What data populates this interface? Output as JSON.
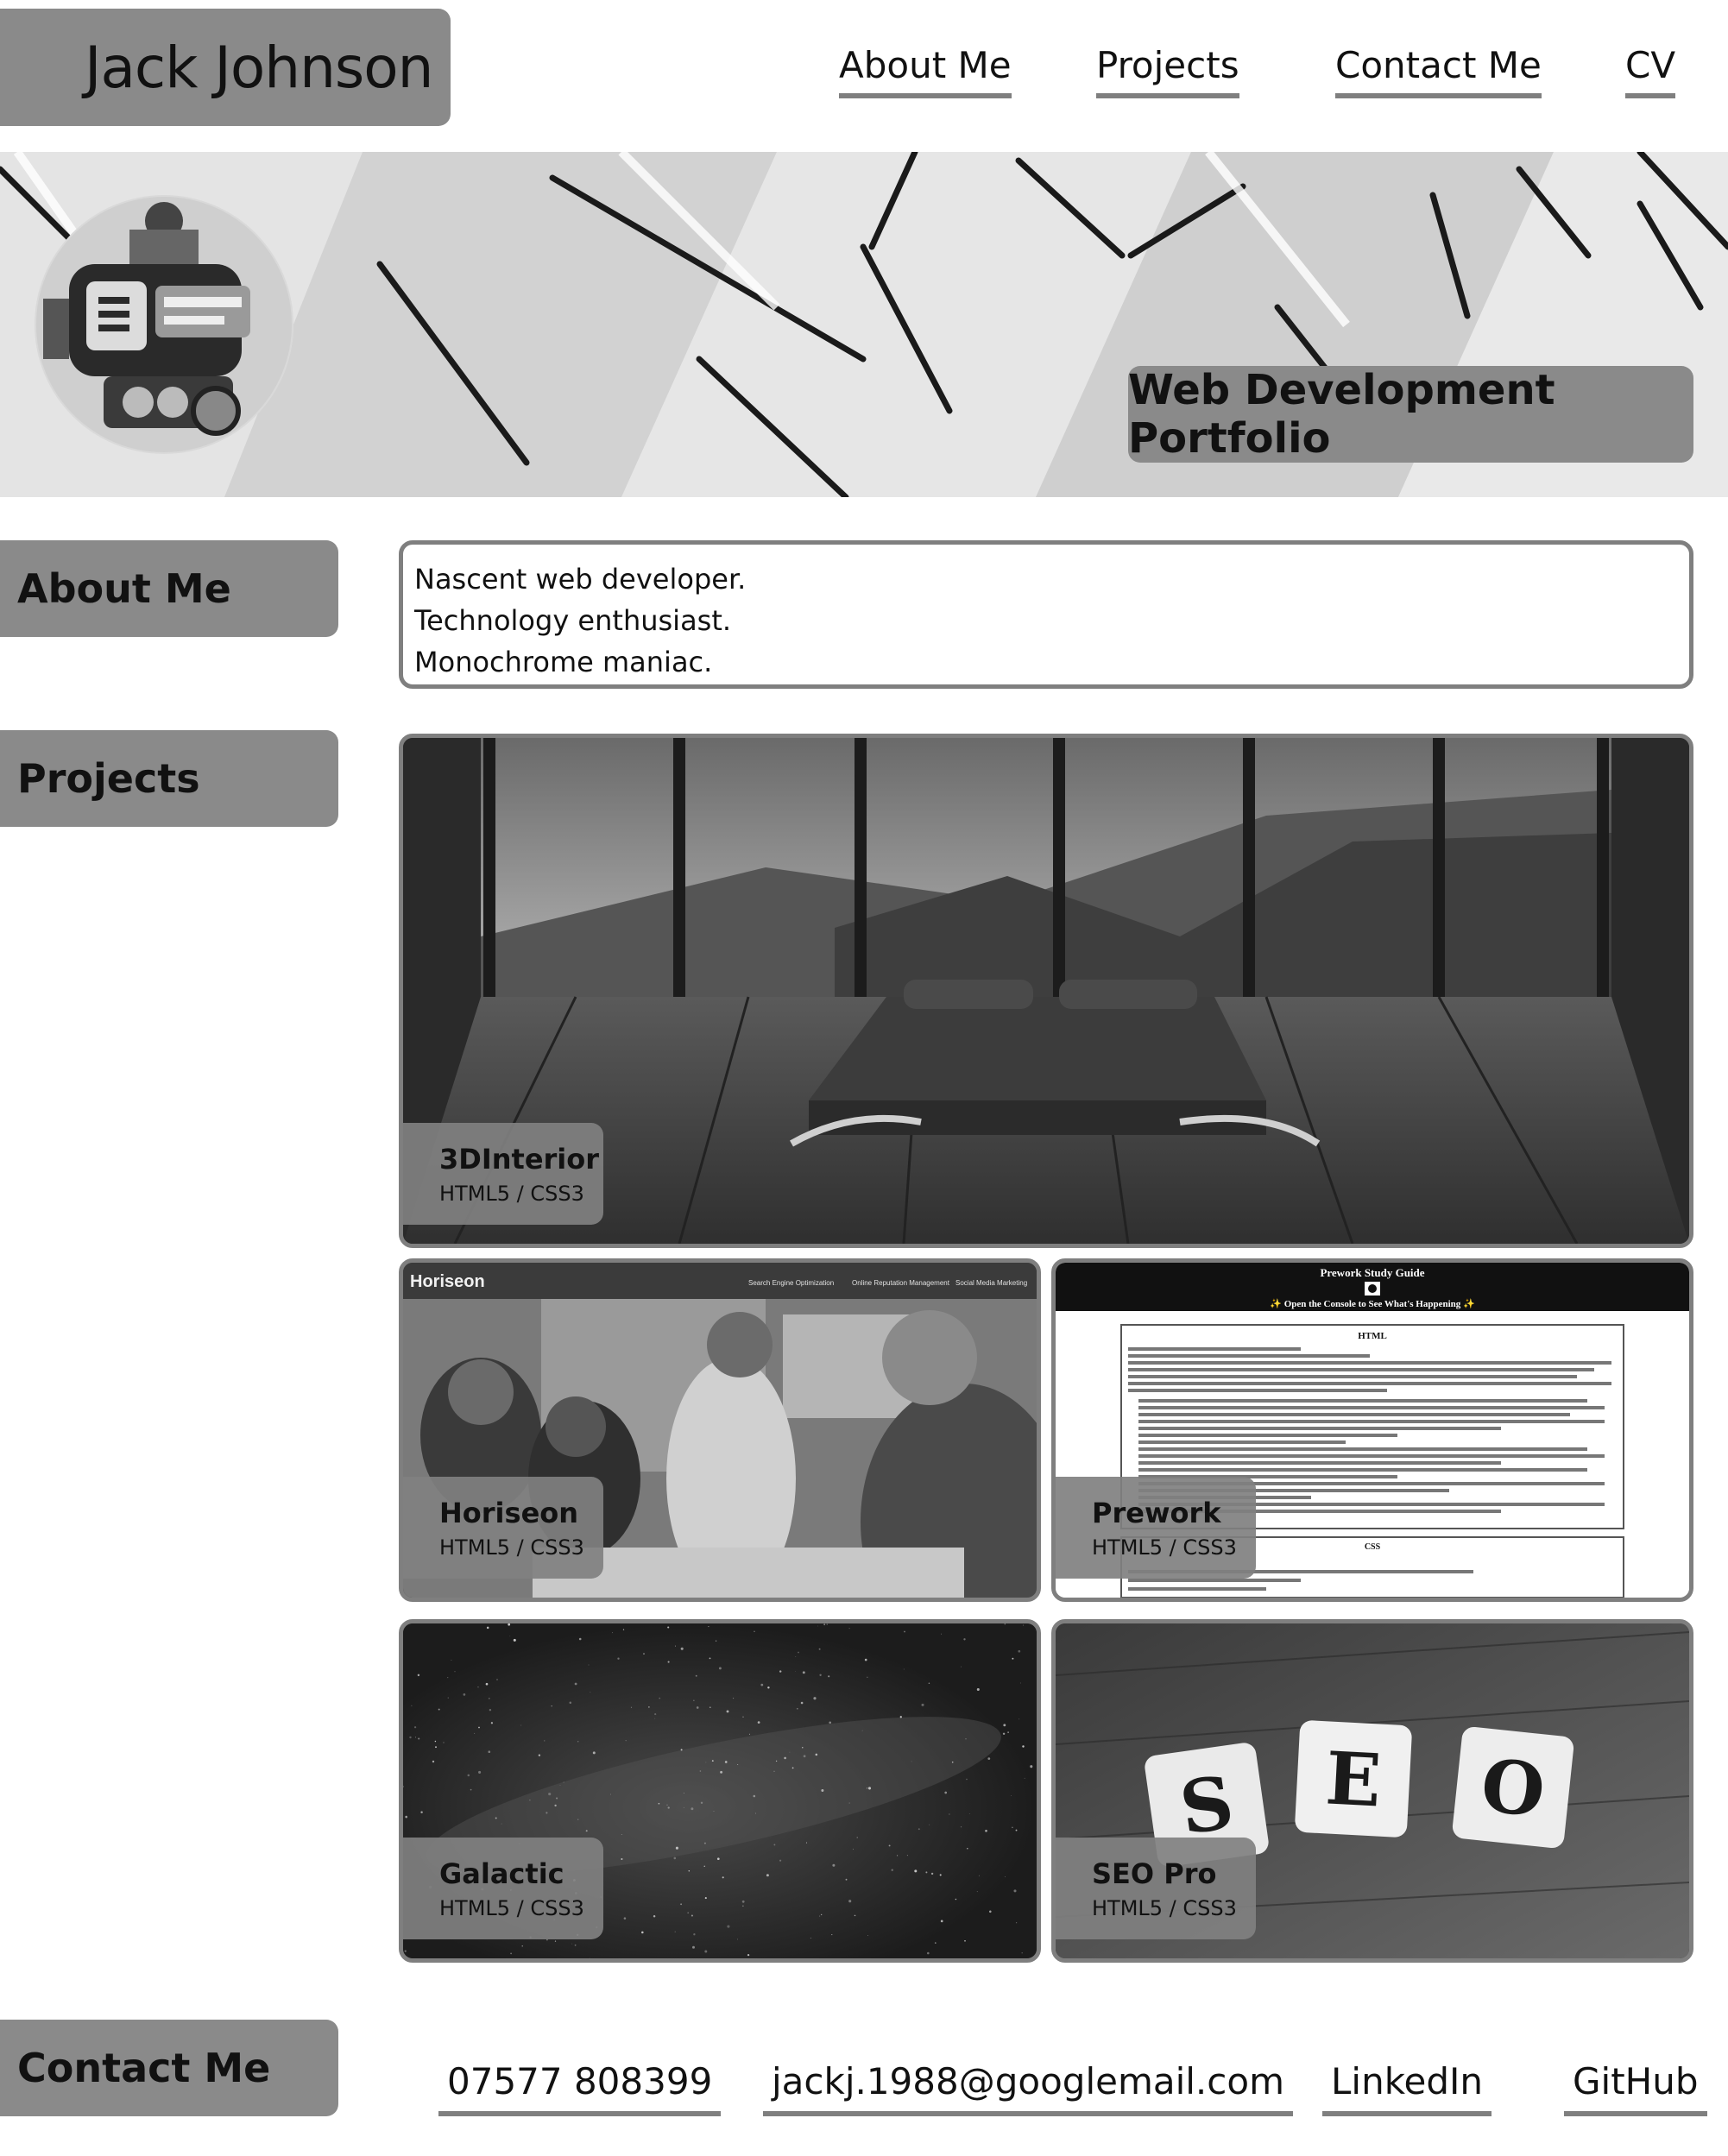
{
  "header": {
    "name": "Jack Johnson",
    "nav": [
      "About Me",
      "Projects",
      "Contact Me",
      "CV"
    ]
  },
  "hero": {
    "title": "Web Development Portfolio"
  },
  "about": {
    "label": "About Me",
    "lines": [
      "Nascent web developer.",
      "Technology enthusiast.",
      "Monochrome maniac."
    ]
  },
  "projects": {
    "label": "Projects",
    "items": [
      {
        "title": "3DInterior",
        "tech": "HTML5 / CSS3"
      },
      {
        "title": "Horiseon",
        "tech": "HTML5 / CSS3"
      },
      {
        "title": "Prework",
        "tech": "HTML5 / CSS3"
      },
      {
        "title": "Galactic",
        "tech": "HTML5 / CSS3"
      },
      {
        "title": "SEO Pro",
        "tech": "HTML5 / CSS3"
      }
    ],
    "horiseon_screenshot": {
      "brand": "Horiseon",
      "nav": [
        "Search Engine Optimization",
        "Online Reputation Management",
        "Social Media Marketing"
      ]
    },
    "prework_screenshot": {
      "title": "Prework Study Guide",
      "subtitle": "✨ Open the Console to See What's Happening ✨",
      "section_html": "HTML",
      "section_css": "CSS"
    },
    "seo_tiles": [
      "S",
      "E",
      "O"
    ]
  },
  "contact": {
    "label": "Contact Me",
    "links": [
      "07577 808399",
      "jackj.1988@googlemail.com",
      "LinkedIn",
      "GitHub"
    ]
  },
  "colors": {
    "accent_gray": "#8a8a8a",
    "border_gray": "#7f7f7f",
    "text": "#111111",
    "background": "#ffffff"
  }
}
